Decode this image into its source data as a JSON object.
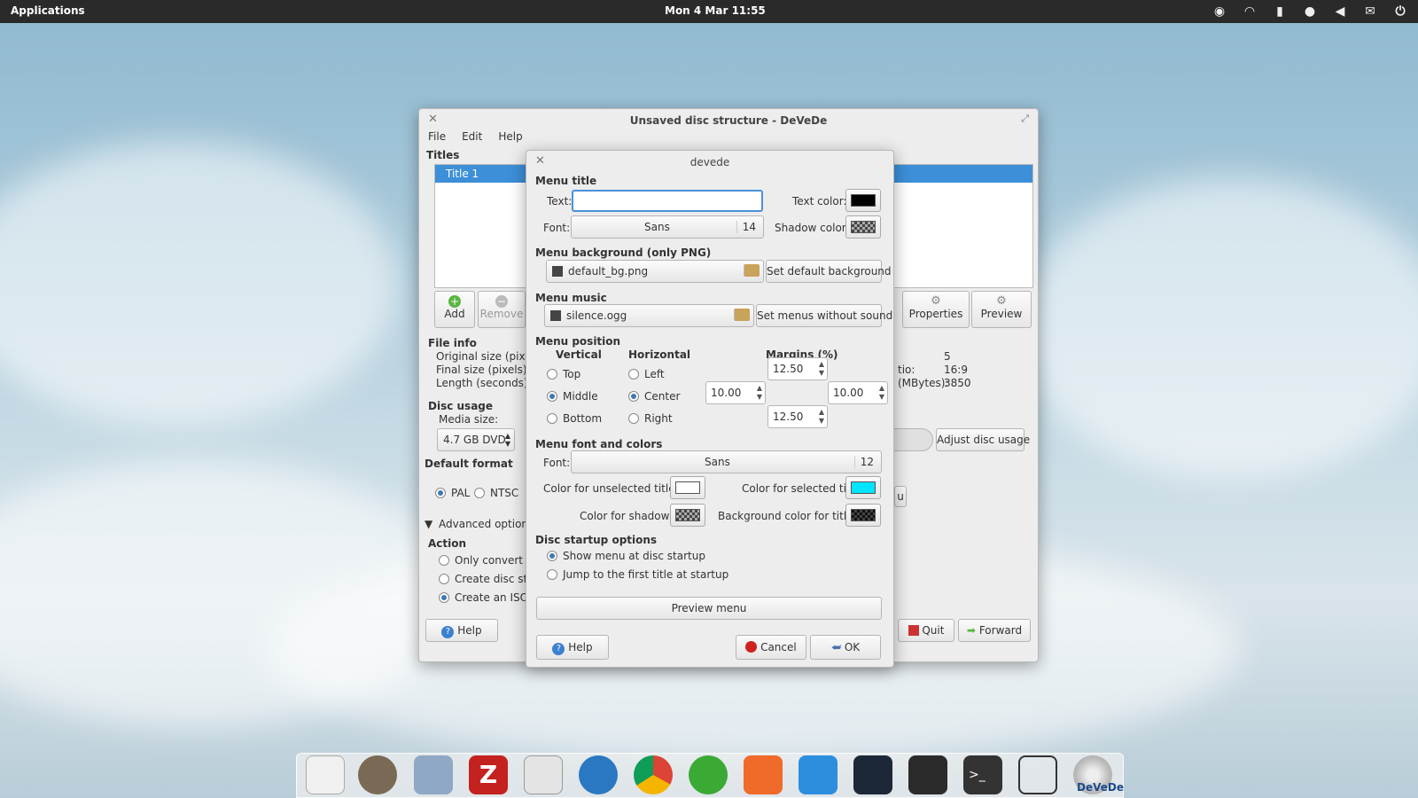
{
  "top_panel": {
    "applications": "Applications",
    "clock": "Mon  4 Mar 11:55",
    "tray_icons": [
      "spotify-icon",
      "wifi-icon",
      "battery-icon",
      "user-icon",
      "volume-icon",
      "mail-icon",
      "power-icon"
    ]
  },
  "main_window": {
    "title": "Unsaved disc structure - DeVeDe",
    "menu": [
      "File",
      "Edit",
      "Help"
    ],
    "titles_label": "Titles",
    "title_item": "Title 1",
    "add": "Add",
    "remove": "Remove",
    "properties": "Properties",
    "preview": "Preview",
    "file_info": "File info",
    "original_size": "Original size (pixels",
    "final_size": "Final size (pixels):",
    "length": "Length (seconds):",
    "val_5": "5",
    "ratio_label": "tio:",
    "ratio_value": "16:9",
    "mbytes_label": "(MBytes):",
    "mbytes_value": "3850",
    "disc_usage": "Disc usage",
    "media_size": "Media size:",
    "media_value": "4.7 GB DVD",
    "adjust": "Adjust disc usage",
    "default_format": "Default format",
    "pal": "PAL",
    "ntsc": "NTSC",
    "advanced": "Advanced options",
    "action": "Action",
    "only_convert": "Only convert fi",
    "create_disc": "Create disc stru",
    "create_iso": "Create an ISO c",
    "u_btn": "u",
    "help": "Help",
    "quit": "Quit",
    "forward": "Forward"
  },
  "dialog": {
    "title": "devede",
    "menu_title": "Menu title",
    "text_label": "Text:",
    "text_value": "",
    "text_color": "Text color:",
    "font_label": "Font:",
    "font_name": "Sans",
    "font_size": "14",
    "shadow_color": "Shadow color:",
    "menu_bg": "Menu background (only PNG)",
    "bg_file": "default_bg.png",
    "set_default_bg": "Set default background",
    "menu_music": "Menu music",
    "music_file": "silence.ogg",
    "set_no_sound": "Set menus without sound",
    "menu_position": "Menu position",
    "vertical": "Vertical",
    "horizontal": "Horizontal",
    "margins": "Margins (%)",
    "top": "Top",
    "middle": "Middle",
    "bottom": "Bottom",
    "left": "Left",
    "center": "Center",
    "right": "Right",
    "margin_top": "12.50",
    "margin_left": "10.00",
    "margin_right": "10.00",
    "margin_bottom": "12.50",
    "font_colors": "Menu font and colors",
    "font_label2": "Font:",
    "font_name2": "Sans",
    "font_size2": "12",
    "unselected": "Color for unselected titles:",
    "selected": "Color for selected title:",
    "shadows": "Color for shadows:",
    "bg_titles": "Background color for titles:",
    "startup": "Disc startup options",
    "show_menu": "Show menu at disc startup",
    "jump_first": "Jump to the first title at startup",
    "preview_menu": "Preview menu",
    "help": "Help",
    "cancel": "Cancel",
    "ok": "OK",
    "colors": {
      "text": "#000000",
      "unselected": "#ffffff",
      "selected": "#00e5ff",
      "bg_titles": "#111111"
    }
  },
  "dock": {
    "apps": [
      "text-editor-icon",
      "gimp-icon",
      "files-icon",
      "filezilla-icon",
      "multitasking-icon",
      "browser-icon",
      "chrome-icon",
      "spotify-icon",
      "update-icon",
      "download-icon",
      "steam-icon",
      "system-monitor-icon",
      "terminal-icon",
      "lotus-icon",
      "devede-icon"
    ],
    "devede_label": "DeVeDe"
  }
}
